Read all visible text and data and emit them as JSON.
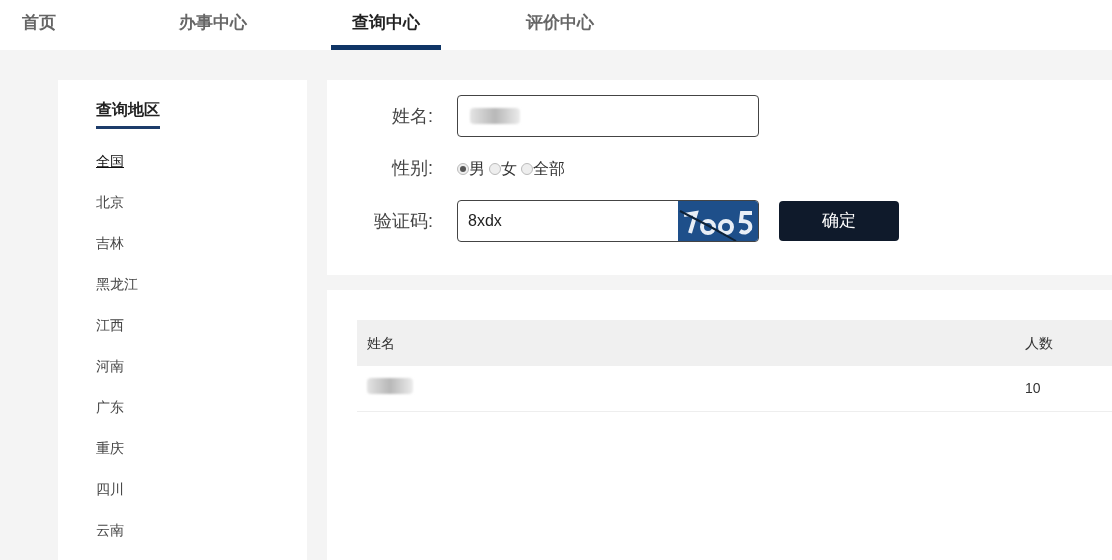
{
  "nav": [
    {
      "label": "首页",
      "selected": false
    },
    {
      "label": "办事中心",
      "selected": false
    },
    {
      "label": "查询中心",
      "selected": true
    },
    {
      "label": "评价中心",
      "selected": false
    }
  ],
  "sidebar": {
    "title": "查询地区",
    "items": [
      {
        "label": "全国",
        "selected": true
      },
      {
        "label": "北京",
        "selected": false
      },
      {
        "label": "吉林",
        "selected": false
      },
      {
        "label": "黑龙江",
        "selected": false
      },
      {
        "label": "江西",
        "selected": false
      },
      {
        "label": "河南",
        "selected": false
      },
      {
        "label": "广东",
        "selected": false
      },
      {
        "label": "重庆",
        "selected": false
      },
      {
        "label": "四川",
        "selected": false
      },
      {
        "label": "云南",
        "selected": false
      }
    ]
  },
  "form": {
    "name_label": "姓名:",
    "gender_label": "性别:",
    "genders": [
      {
        "label": "男",
        "selected": true
      },
      {
        "label": "女",
        "selected": false
      },
      {
        "label": "全部",
        "selected": false
      }
    ],
    "captcha_label": "验证码:",
    "captcha_value": "8xdx",
    "submit": "确定"
  },
  "table": {
    "columns": [
      "姓名",
      "人数"
    ],
    "rows": [
      {
        "count": "10"
      }
    ]
  }
}
